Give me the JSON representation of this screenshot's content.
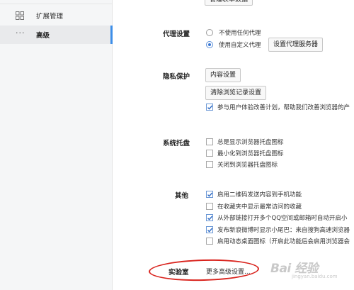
{
  "sidebar": {
    "items": [
      {
        "label": "扩展管理",
        "icon": "grid-icon"
      },
      {
        "label": "高级",
        "icon": "more-dots-icon",
        "active": true
      }
    ],
    "accent_color": "#3d8ee8"
  },
  "top_button": {
    "label": "管理表单数据"
  },
  "proxy": {
    "label": "代理设置",
    "options": [
      {
        "label": "不使用任何代理",
        "selected": false
      },
      {
        "label": "使用自定义代理",
        "selected": true
      }
    ],
    "server_button": "设置代理服务器"
  },
  "privacy": {
    "label": "隐私保护",
    "content_button": "内容设置",
    "clear_button": "清除浏览记录设置",
    "options": [
      {
        "label": "参与用户体验改善计划，帮助我们改善浏览器的产",
        "checked": true
      }
    ]
  },
  "tray": {
    "label": "系统托盘",
    "options": [
      {
        "label": "总是显示浏览器托盘图标",
        "checked": false
      },
      {
        "label": "最小化到浏览器托盘图标",
        "checked": false
      },
      {
        "label": "关闭到浏览器托盘图标",
        "checked": false
      }
    ]
  },
  "other": {
    "label": "其他",
    "options": [
      {
        "label": "启用二维码发送内容到手机功能",
        "checked": true
      },
      {
        "label": "在收藏夹中显示最常访问的收藏",
        "checked": false
      },
      {
        "label": "从外部链接打开多个QQ空间或邮箱时自动开启小",
        "checked": true
      },
      {
        "label": "发布新浪微博时显示小尾巴：来自搜狗高速浏览器",
        "checked": true
      },
      {
        "label": "启用动态桌面图标（开启此功能后会启用浏览器会",
        "checked": false
      }
    ]
  },
  "lab": {
    "label": "实验室",
    "link": "更多高级设置..."
  },
  "annotation_color": "#d9231d",
  "watermark": {
    "main": "Bai 经验",
    "sub": "jingyan.baidu.com"
  }
}
